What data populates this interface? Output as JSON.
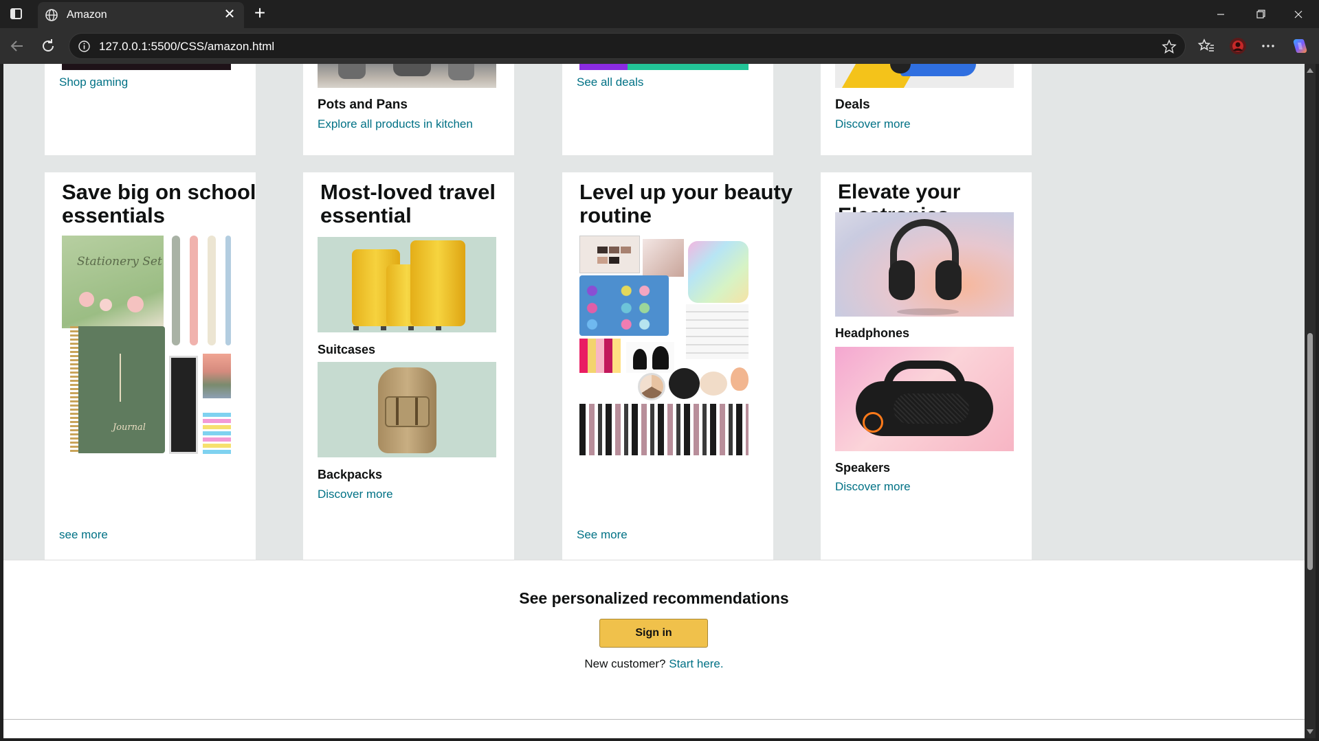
{
  "browser": {
    "tab_title": "Amazon",
    "url": "127.0.0.1:5500/CSS/amazon.html",
    "icons": [
      "tab-actions-icon",
      "globe-icon",
      "close-icon",
      "new-tab-icon",
      "minimize-icon",
      "maximize-icon",
      "window-close-icon",
      "back-icon",
      "reload-icon",
      "site-info-icon",
      "favorite-star-icon",
      "favorites-icon",
      "profile-icon",
      "more-icon",
      "copilot-icon"
    ]
  },
  "top_row": {
    "card1": {
      "link": "Shop gaming"
    },
    "card2": {
      "subtitle": "Pots and Pans",
      "link": "Explore all products in kitchen"
    },
    "card3": {
      "link": "See all deals"
    },
    "card4": {
      "subtitle": "Deals",
      "link": "Discover more"
    }
  },
  "cards": {
    "school": {
      "title": "Save big on school essentials",
      "image_text": "Stationery Set",
      "journal_text": "Journal",
      "link": "see more"
    },
    "travel": {
      "title": "Most-loved travel essential",
      "item1": "Suitcases",
      "item2": "Backpacks",
      "link": "Discover more"
    },
    "beauty": {
      "title": "Level up your beauty routine",
      "link": "See more"
    },
    "electronics": {
      "title": "Elevate your Electronics",
      "item1": "Headphones",
      "item2": "Speakers",
      "link": "Discover more"
    }
  },
  "signin": {
    "heading": "See personalized recommendations",
    "button": "Sign in",
    "new_customer": "New customer?",
    "start_here": "Start here."
  },
  "colors": {
    "link": "#007185",
    "page_bg": "#e3e6e6",
    "signin_button": "#f0c14b"
  }
}
